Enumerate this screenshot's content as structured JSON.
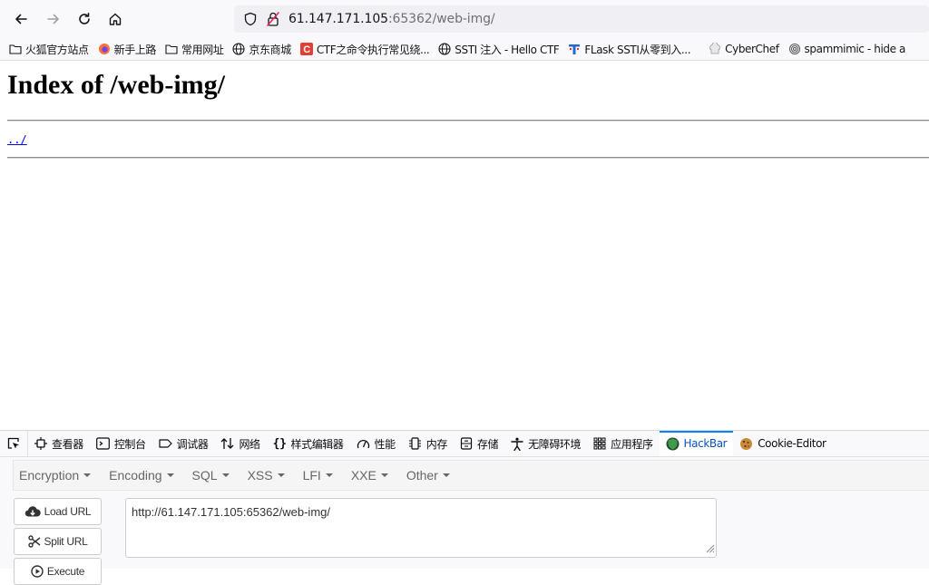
{
  "browser": {
    "url": {
      "host": "61.147.171.105",
      "rest": ":65362/web-img/"
    },
    "icons": [
      "back-arrow-icon",
      "forward-arrow-icon",
      "reload-icon",
      "home-icon",
      "shield-icon",
      "insecure-lock-icon"
    ]
  },
  "bookmarks": [
    {
      "label": "火狐官方站点",
      "icon": "folder-icon"
    },
    {
      "label": "新手上路",
      "icon": "firefox-icon"
    },
    {
      "label": "常用网址",
      "icon": "folder-icon"
    },
    {
      "label": "京东商城",
      "icon": "globe-icon"
    },
    {
      "label": "CTF之命令执行常见绕...",
      "icon": "csdn-icon"
    },
    {
      "label": "SSTI 注入 - Hello CTF",
      "icon": "globe-icon"
    },
    {
      "label": "FLask SSTI从零到入...",
      "icon": "site-icon"
    },
    {
      "label": "CyberChef",
      "icon": "chef-hat-icon"
    },
    {
      "label": "spammimic - hide a",
      "icon": "fingerprint-icon"
    }
  ],
  "page": {
    "heading": "Index of /web-img/",
    "parent_link": "../"
  },
  "devtools": {
    "tabs": [
      {
        "label": "查看器",
        "icon": "inspector-icon"
      },
      {
        "label": "控制台",
        "icon": "console-icon"
      },
      {
        "label": "调试器",
        "icon": "debugger-icon"
      },
      {
        "label": "网络",
        "icon": "network-icon"
      },
      {
        "label": "样式编辑器",
        "icon": "style-editor-icon"
      },
      {
        "label": "性能",
        "icon": "performance-icon"
      },
      {
        "label": "内存",
        "icon": "memory-icon"
      },
      {
        "label": "存储",
        "icon": "storage-icon"
      },
      {
        "label": "无障碍环境",
        "icon": "accessibility-icon"
      },
      {
        "label": "应用程序",
        "icon": "application-icon"
      },
      {
        "label": "HackBar",
        "icon": "hackbar-icon",
        "active": true
      },
      {
        "label": "Cookie-Editor",
        "icon": "cookie-icon"
      }
    ],
    "accent": "#0a84ff"
  },
  "hackbar": {
    "menu": [
      "Encryption",
      "Encoding",
      "SQL",
      "XSS",
      "LFI",
      "XXE",
      "Other"
    ],
    "buttons": {
      "load": "Load URL",
      "split": "Split URL",
      "execute": "Execute"
    },
    "url_value": "http://61.147.171.105:65362/web-img/"
  }
}
